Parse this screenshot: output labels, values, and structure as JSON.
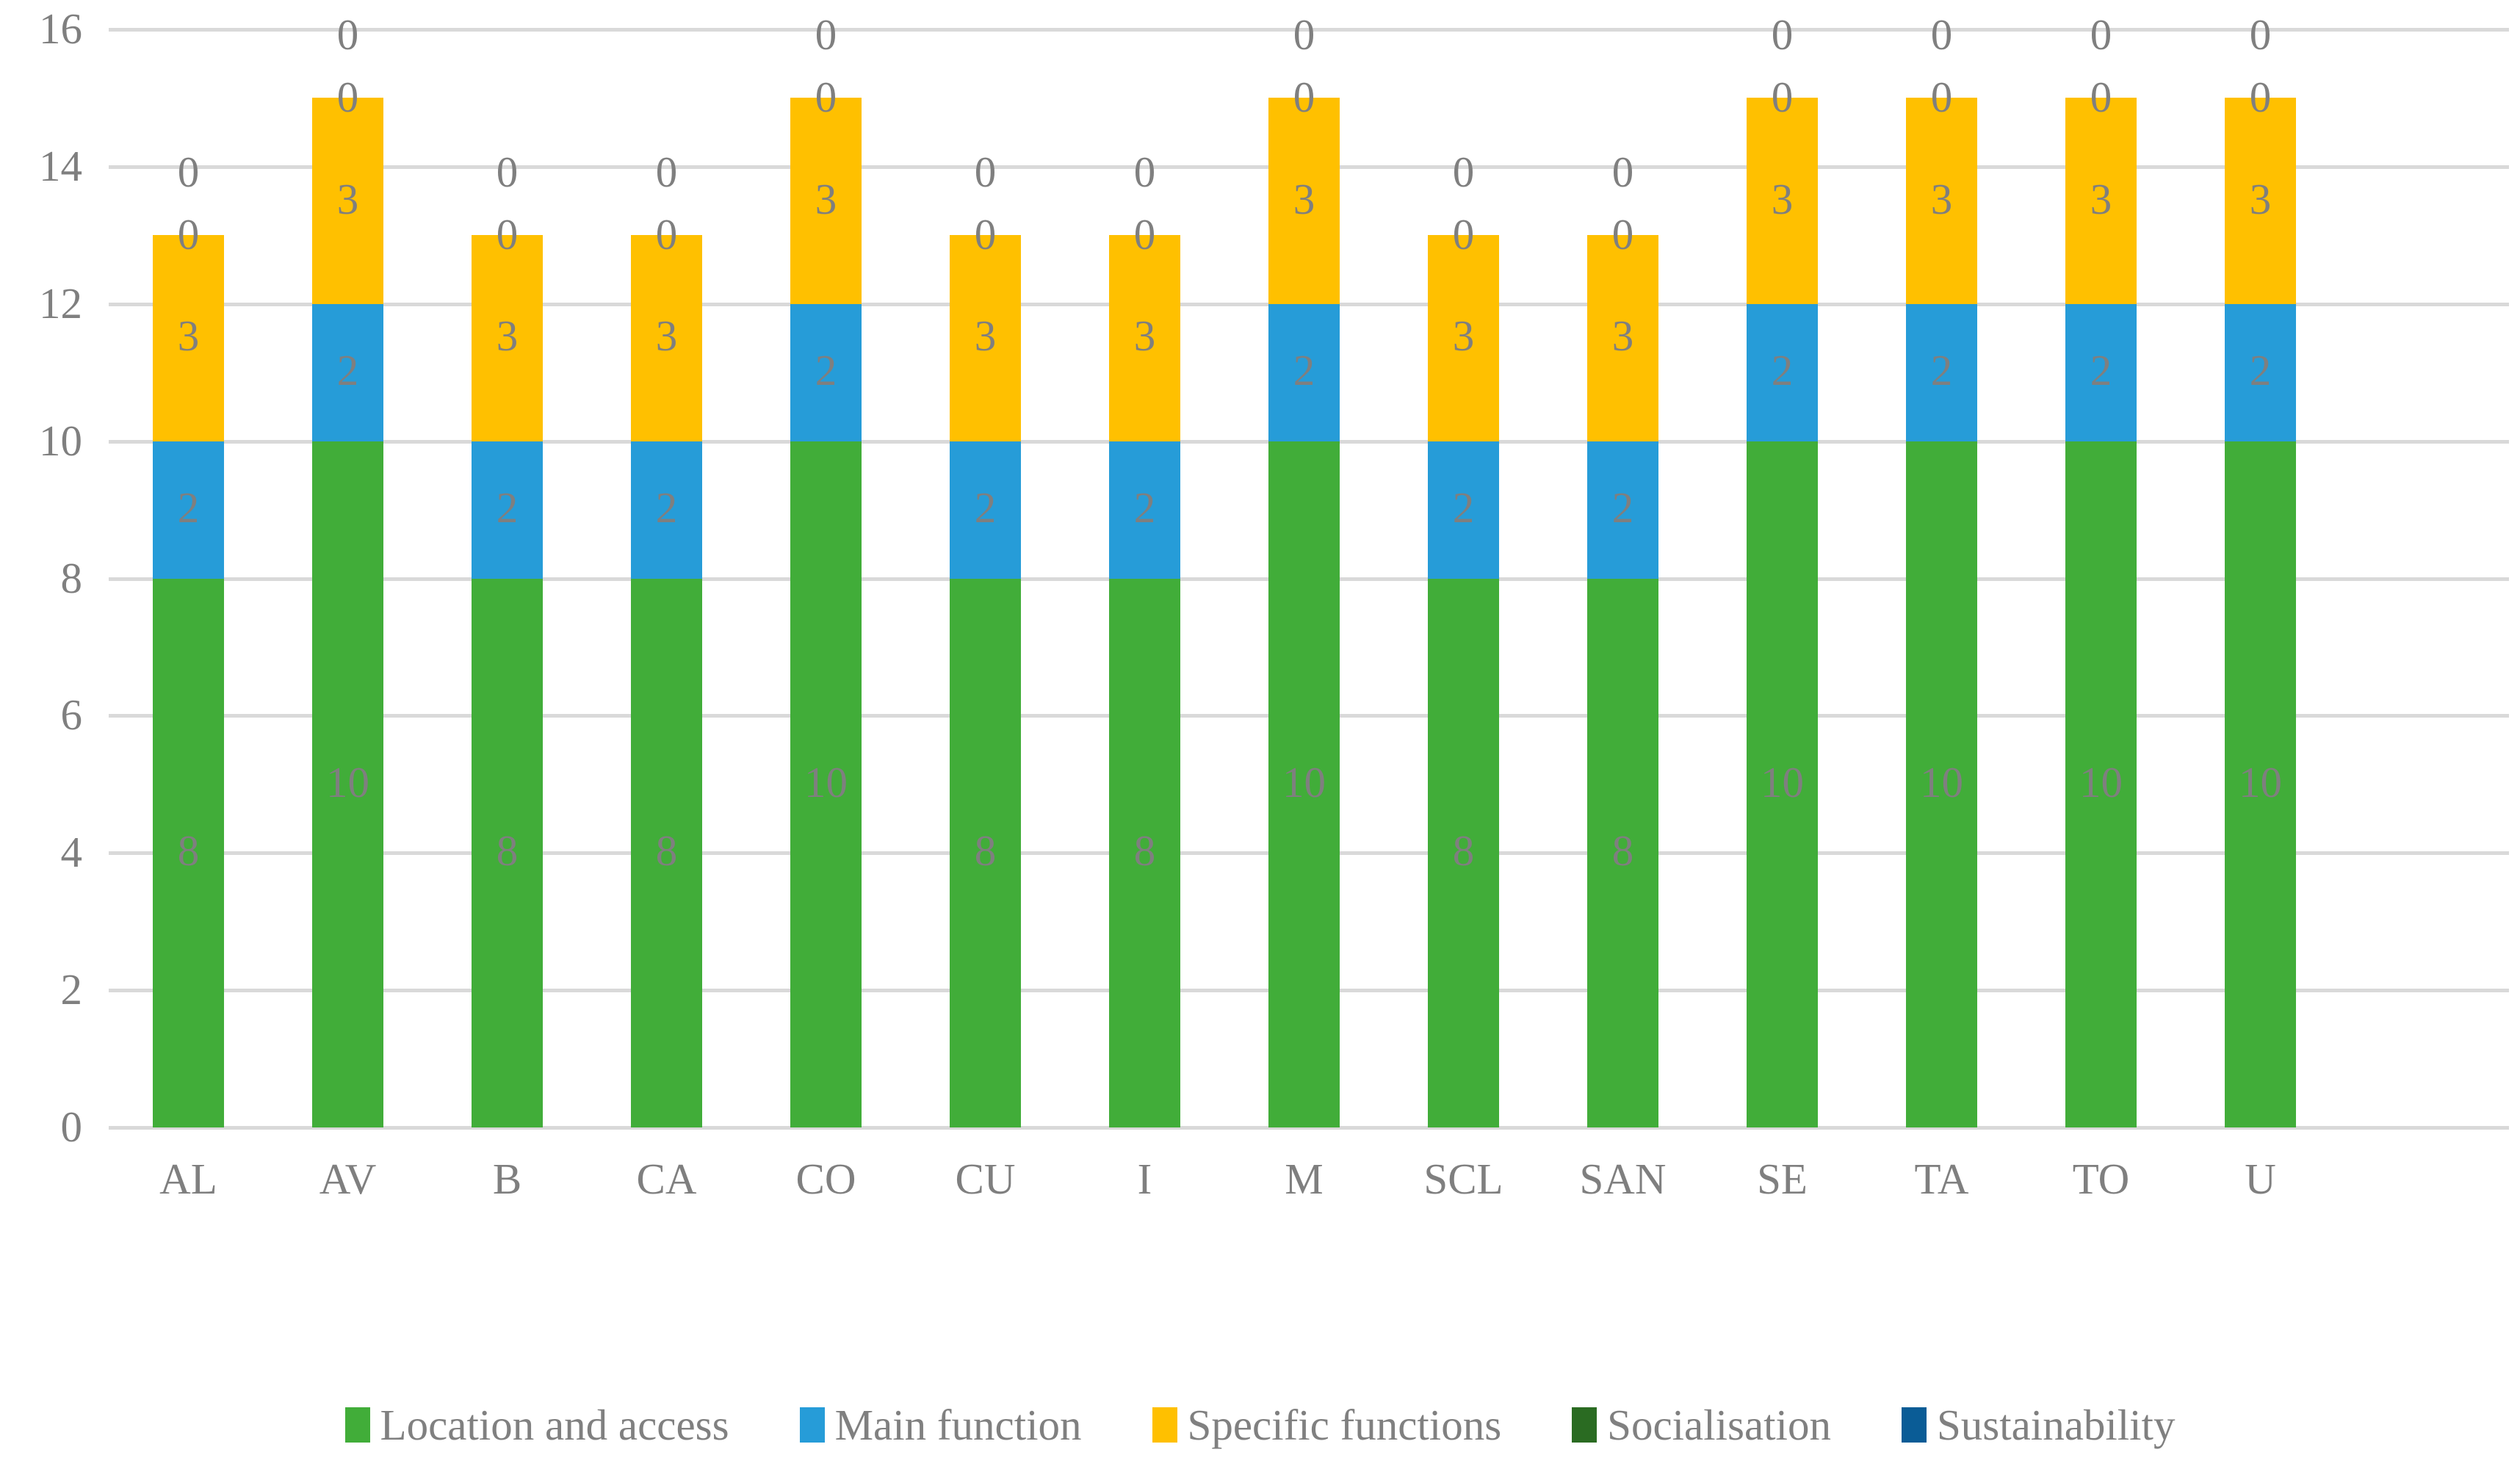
{
  "chart_data": {
    "type": "bar",
    "subtype": "stacked-bar",
    "title": "",
    "subtitle": "",
    "xlabel": "",
    "ylabel": "",
    "ylim": [
      0,
      16
    ],
    "ytick_labels": [
      "0",
      "2",
      "4",
      "6",
      "8",
      "10",
      "12",
      "14",
      "16"
    ],
    "ytick_values": [
      0,
      2,
      4,
      6,
      8,
      10,
      12,
      14,
      16
    ],
    "grid": true,
    "legend_position": "bottom",
    "categories": [
      "AL",
      "AV",
      "B",
      "CA",
      "CO",
      "CU",
      "I",
      "M",
      "SCL",
      "SAN",
      "SE",
      "TA",
      "TO",
      "U"
    ],
    "series": [
      {
        "name": "Location and access",
        "color": "#41AD39",
        "values": [
          8,
          10,
          8,
          8,
          10,
          8,
          8,
          10,
          8,
          8,
          10,
          10,
          10,
          10
        ]
      },
      {
        "name": "Main function",
        "color": "#269CD8",
        "values": [
          2,
          2,
          2,
          2,
          2,
          2,
          2,
          2,
          2,
          2,
          2,
          2,
          2,
          2
        ]
      },
      {
        "name": "Specific functions",
        "color": "#FFC000",
        "values": [
          3,
          3,
          3,
          3,
          3,
          3,
          3,
          3,
          3,
          3,
          3,
          3,
          3,
          3
        ]
      },
      {
        "name": "Socialisation",
        "color": "#2A6B22",
        "values": [
          0,
          0,
          0,
          0,
          0,
          0,
          0,
          0,
          0,
          0,
          0,
          0,
          0,
          0
        ]
      },
      {
        "name": "Sustainability",
        "color": "#0A5C96",
        "values": [
          0,
          0,
          0,
          0,
          0,
          0,
          0,
          0,
          0,
          0,
          0,
          0,
          0,
          0
        ]
      }
    ],
    "totals": [
      13,
      15,
      13,
      13,
      15,
      13,
      13,
      15,
      13,
      13,
      15,
      15,
      15,
      15
    ],
    "data_labels_shown": true,
    "axis_colors": {
      "gridline": "#D9D9D9",
      "text": "#7F7F7F",
      "background": "#FFFFFF"
    }
  },
  "legend": {
    "items": [
      {
        "label": "Location and access",
        "color": "#41AD39"
      },
      {
        "label": "Main function",
        "color": "#269CD8"
      },
      {
        "label": "Specific functions",
        "color": "#FFC000"
      },
      {
        "label": "Socialisation",
        "color": "#2A6B22"
      },
      {
        "label": "Sustainability",
        "color": "#0A5C96"
      }
    ]
  }
}
